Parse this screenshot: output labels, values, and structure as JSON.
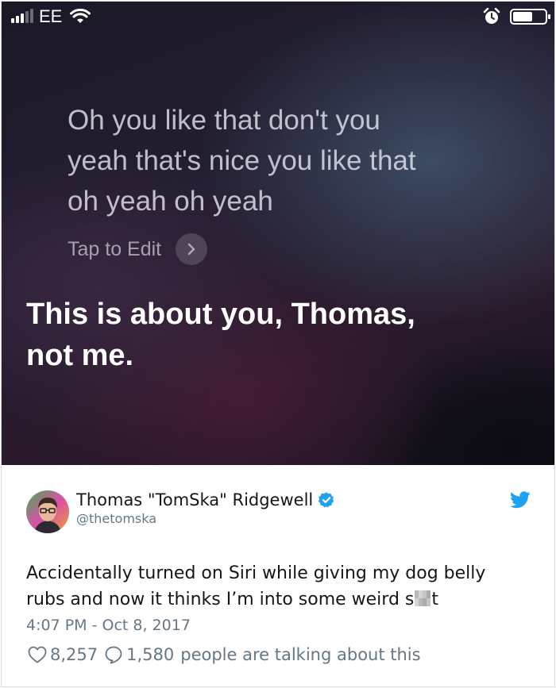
{
  "status_bar": {
    "carrier": "EE",
    "signal_bars_filled": 3,
    "signal_bars_total": 5
  },
  "siri": {
    "transcript_lines": [
      "Oh you like that don't you",
      "yeah that's nice you like that",
      "oh yeah oh yeah"
    ],
    "tap_to_edit": "Tap to Edit",
    "response_lines": [
      "This is about you, Thomas,",
      "not me."
    ]
  },
  "tweet": {
    "display_name": "Thomas \"TomSka\" Ridgewell",
    "handle": "@thetomska",
    "text_line_1": "Accidentally turned on Siri while giving my dog belly",
    "text_line_2_before": "rubs and now it thinks I’m into some weird s",
    "text_line_2_after": "t",
    "timestamp": "4:07 PM - Oct 8, 2017",
    "likes": "8,257",
    "replies": "1,580",
    "talking_text": "people are talking about this"
  },
  "icons": {
    "wifi": "wifi-icon",
    "alarm": "alarm-icon",
    "battery": "battery-icon",
    "chevron": "chevron-right-icon",
    "verified": "verified-badge-icon",
    "twitter": "twitter-bird-icon",
    "heart": "heart-icon",
    "reply": "reply-bubble-icon"
  },
  "colors": {
    "twitter_blue": "#1da1f2",
    "secondary_text": "#657786",
    "primary_text": "#14171a"
  }
}
